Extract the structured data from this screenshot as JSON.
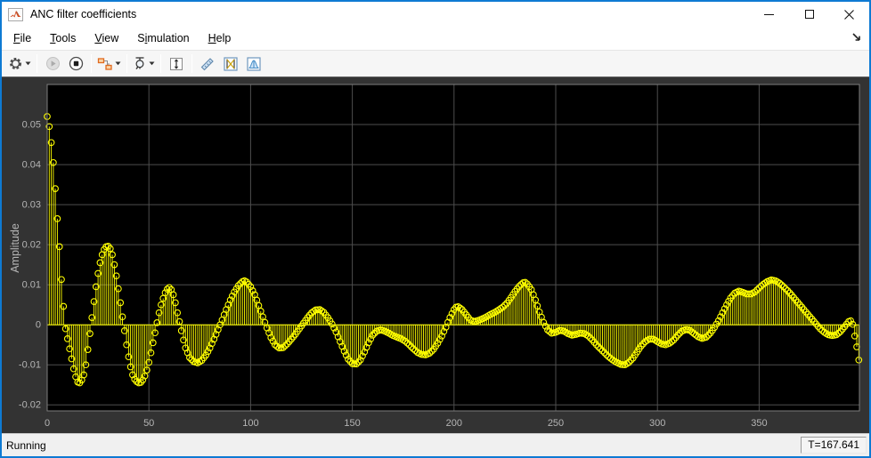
{
  "window": {
    "title": "ANC filter coefficients",
    "controls": {
      "minimize": "Minimize",
      "maximize": "Maximize",
      "close": "Close"
    }
  },
  "menu": {
    "items": [
      {
        "id": "file",
        "label": "File",
        "mnemonic": "F"
      },
      {
        "id": "tools",
        "label": "Tools",
        "mnemonic": "T"
      },
      {
        "id": "view",
        "label": "View",
        "mnemonic": "V"
      },
      {
        "id": "simulation",
        "label": "Simulation",
        "mnemonic": "i"
      },
      {
        "id": "help",
        "label": "Help",
        "mnemonic": "H"
      }
    ],
    "dock_icon": "dock-arrow-icon"
  },
  "toolbar": {
    "buttons": [
      {
        "id": "settings",
        "icon": "gear-icon",
        "dropdown": true,
        "enabled": true
      },
      {
        "sep": true
      },
      {
        "id": "run",
        "icon": "play-icon",
        "dropdown": false,
        "enabled": false
      },
      {
        "id": "stop",
        "icon": "stop-icon",
        "dropdown": false,
        "enabled": true
      },
      {
        "sep": true
      },
      {
        "id": "highlight-simulink-block",
        "icon": "simulink-blocks-icon",
        "dropdown": true,
        "enabled": true
      },
      {
        "sep": true
      },
      {
        "id": "zoom-tools",
        "icon": "zoom-span-icon",
        "dropdown": true,
        "enabled": true
      },
      {
        "sep": true
      },
      {
        "id": "scale-axes-limits",
        "icon": "scale-axes-icon",
        "dropdown": false,
        "enabled": true
      },
      {
        "sep": true
      },
      {
        "id": "measurements-ruler",
        "icon": "ruler-icon",
        "dropdown": false,
        "enabled": true
      },
      {
        "id": "cursor-measurements",
        "icon": "cursor-measurements-icon",
        "dropdown": false,
        "enabled": true
      },
      {
        "id": "signal-statistics",
        "icon": "signal-statistics-icon",
        "dropdown": false,
        "enabled": true
      }
    ]
  },
  "status_bar": {
    "state": "Running",
    "time": "T=167.641"
  },
  "colors": {
    "window_border": "#0e7ad3",
    "figure_background": "#333333",
    "axes_background": "#000000",
    "grid": "#4e4e4e",
    "axes_box": "#7d7d7d",
    "tick_label": "#b5b5b5",
    "stem": "#ffff00"
  },
  "chart_data": {
    "type": "stem",
    "title": "",
    "xlabel": "",
    "ylabel": "Amplitude",
    "xlim": [
      0,
      399.3
    ],
    "ylim": [
      -0.0215,
      0.06
    ],
    "x_ticks": [
      0,
      50,
      100,
      150,
      200,
      250,
      300,
      350
    ],
    "y_ticks": [
      -0.02,
      -0.01,
      0,
      0.01,
      0.02,
      0.03,
      0.04,
      0.05
    ],
    "y_tick_labels": [
      "-0.02",
      "-0.01",
      "0",
      "0.01",
      "0.02",
      "0.03",
      "0.04",
      "0.05"
    ],
    "grid": true,
    "legend": null,
    "n_samples": 400,
    "sampling_note": "400 filter taps; stems at every integer sample, values linearly interpolated from control_points read off the plot",
    "control_points": [
      [
        0,
        0.052
      ],
      [
        1,
        0.0495
      ],
      [
        2,
        0.0455
      ],
      [
        3,
        0.0405
      ],
      [
        4,
        0.034
      ],
      [
        5,
        0.0265
      ],
      [
        6,
        0.0195
      ],
      [
        7,
        0.0113
      ],
      [
        8,
        0.0046
      ],
      [
        9,
        -0.001
      ],
      [
        10,
        -0.0035
      ],
      [
        11,
        -0.006
      ],
      [
        12,
        -0.0085
      ],
      [
        13,
        -0.011
      ],
      [
        14,
        -0.013
      ],
      [
        15,
        -0.0143
      ],
      [
        16,
        -0.0145
      ],
      [
        17,
        -0.0138
      ],
      [
        18,
        -0.0125
      ],
      [
        19,
        -0.01
      ],
      [
        20,
        -0.0062
      ],
      [
        21,
        -0.0022
      ],
      [
        22,
        0.0018
      ],
      [
        23,
        0.0058
      ],
      [
        24,
        0.0095
      ],
      [
        25,
        0.0128
      ],
      [
        26,
        0.0155
      ],
      [
        27,
        0.0175
      ],
      [
        28,
        0.0188
      ],
      [
        29,
        0.0195
      ],
      [
        30,
        0.0196
      ],
      [
        31,
        0.019
      ],
      [
        32,
        0.0175
      ],
      [
        33,
        0.015
      ],
      [
        34,
        0.0122
      ],
      [
        35,
        0.009
      ],
      [
        36,
        0.0055
      ],
      [
        37,
        0.002
      ],
      [
        38,
        -0.0015
      ],
      [
        39,
        -0.005
      ],
      [
        40,
        -0.008
      ],
      [
        41,
        -0.0105
      ],
      [
        42,
        -0.0125
      ],
      [
        43,
        -0.0136
      ],
      [
        44,
        -0.0142
      ],
      [
        45,
        -0.0145
      ],
      [
        46,
        -0.0144
      ],
      [
        47,
        -0.0138
      ],
      [
        48,
        -0.0128
      ],
      [
        49,
        -0.0113
      ],
      [
        50,
        -0.0094
      ],
      [
        51,
        -0.007
      ],
      [
        52,
        -0.0045
      ],
      [
        53,
        -0.002
      ],
      [
        54,
        0.0005
      ],
      [
        55,
        0.003
      ],
      [
        56,
        0.005
      ],
      [
        57,
        0.0066
      ],
      [
        58,
        0.008
      ],
      [
        59,
        0.0089
      ],
      [
        60,
        0.0093
      ],
      [
        61,
        0.0088
      ],
      [
        62,
        0.0075
      ],
      [
        63,
        0.0055
      ],
      [
        64,
        0.003
      ],
      [
        65,
        0.0008
      ],
      [
        66,
        -0.0015
      ],
      [
        67,
        -0.0038
      ],
      [
        68,
        -0.0058
      ],
      [
        70,
        -0.0082
      ],
      [
        72,
        -0.0092
      ],
      [
        74,
        -0.0095
      ],
      [
        76,
        -0.0089
      ],
      [
        78,
        -0.0076
      ],
      [
        80,
        -0.0058
      ],
      [
        82,
        -0.0036
      ],
      [
        84,
        -0.0012
      ],
      [
        86,
        0.0012
      ],
      [
        88,
        0.0038
      ],
      [
        90,
        0.0062
      ],
      [
        92,
        0.0082
      ],
      [
        94,
        0.0098
      ],
      [
        96,
        0.0108
      ],
      [
        97,
        0.011
      ],
      [
        98,
        0.0107
      ],
      [
        100,
        0.0095
      ],
      [
        102,
        0.0075
      ],
      [
        104,
        0.0048
      ],
      [
        106,
        0.002
      ],
      [
        108,
        -0.0008
      ],
      [
        110,
        -0.0032
      ],
      [
        112,
        -0.005
      ],
      [
        114,
        -0.0058
      ],
      [
        116,
        -0.0057
      ],
      [
        118,
        -0.0048
      ],
      [
        120,
        -0.0036
      ],
      [
        122,
        -0.0024
      ],
      [
        124,
        -0.001
      ],
      [
        126,
        0.0004
      ],
      [
        128,
        0.0018
      ],
      [
        130,
        0.003
      ],
      [
        132,
        0.0037
      ],
      [
        134,
        0.0038
      ],
      [
        136,
        0.0031
      ],
      [
        138,
        0.0018
      ],
      [
        140,
        0.0002
      ],
      [
        142,
        -0.0018
      ],
      [
        144,
        -0.0042
      ],
      [
        146,
        -0.0066
      ],
      [
        148,
        -0.0086
      ],
      [
        150,
        -0.0097
      ],
      [
        152,
        -0.0098
      ],
      [
        154,
        -0.0088
      ],
      [
        156,
        -0.0068
      ],
      [
        158,
        -0.0045
      ],
      [
        160,
        -0.0026
      ],
      [
        162,
        -0.0016
      ],
      [
        164,
        -0.0013
      ],
      [
        166,
        -0.0016
      ],
      [
        168,
        -0.0021
      ],
      [
        170,
        -0.0027
      ],
      [
        172,
        -0.0031
      ],
      [
        174,
        -0.0035
      ],
      [
        176,
        -0.0041
      ],
      [
        178,
        -0.005
      ],
      [
        180,
        -0.006
      ],
      [
        182,
        -0.0069
      ],
      [
        184,
        -0.0074
      ],
      [
        186,
        -0.0075
      ],
      [
        188,
        -0.0071
      ],
      [
        190,
        -0.0061
      ],
      [
        192,
        -0.0046
      ],
      [
        194,
        -0.0028
      ],
      [
        196,
        -0.0006
      ],
      [
        198,
        0.0018
      ],
      [
        200,
        0.0038
      ],
      [
        201,
        0.0044
      ],
      [
        202,
        0.0045
      ],
      [
        204,
        0.0038
      ],
      [
        206,
        0.0025
      ],
      [
        208,
        0.0012
      ],
      [
        210,
        0.0008
      ],
      [
        212,
        0.0011
      ],
      [
        214,
        0.0015
      ],
      [
        216,
        0.002
      ],
      [
        218,
        0.0026
      ],
      [
        220,
        0.0031
      ],
      [
        222,
        0.0037
      ],
      [
        224,
        0.0044
      ],
      [
        226,
        0.0054
      ],
      [
        228,
        0.0068
      ],
      [
        230,
        0.0083
      ],
      [
        232,
        0.0096
      ],
      [
        234,
        0.0105
      ],
      [
        235,
        0.0106
      ],
      [
        236,
        0.0102
      ],
      [
        238,
        0.0088
      ],
      [
        240,
        0.0062
      ],
      [
        242,
        0.0032
      ],
      [
        244,
        0.0006
      ],
      [
        246,
        -0.0013
      ],
      [
        248,
        -0.0021
      ],
      [
        250,
        -0.0019
      ],
      [
        252,
        -0.0014
      ],
      [
        254,
        -0.0016
      ],
      [
        256,
        -0.0022
      ],
      [
        258,
        -0.0026
      ],
      [
        260,
        -0.0024
      ],
      [
        262,
        -0.0021
      ],
      [
        264,
        -0.0022
      ],
      [
        266,
        -0.0028
      ],
      [
        268,
        -0.0038
      ],
      [
        270,
        -0.005
      ],
      [
        272,
        -0.006
      ],
      [
        274,
        -0.007
      ],
      [
        276,
        -0.008
      ],
      [
        278,
        -0.0088
      ],
      [
        280,
        -0.0094
      ],
      [
        282,
        -0.0099
      ],
      [
        284,
        -0.01
      ],
      [
        286,
        -0.0094
      ],
      [
        288,
        -0.0083
      ],
      [
        290,
        -0.0068
      ],
      [
        292,
        -0.0053
      ],
      [
        294,
        -0.0042
      ],
      [
        296,
        -0.0036
      ],
      [
        298,
        -0.0036
      ],
      [
        300,
        -0.0042
      ],
      [
        302,
        -0.0048
      ],
      [
        304,
        -0.005
      ],
      [
        306,
        -0.0046
      ],
      [
        308,
        -0.0038
      ],
      [
        310,
        -0.0026
      ],
      [
        312,
        -0.0016
      ],
      [
        314,
        -0.0012
      ],
      [
        316,
        -0.0014
      ],
      [
        318,
        -0.0022
      ],
      [
        320,
        -0.003
      ],
      [
        322,
        -0.0034
      ],
      [
        324,
        -0.0031
      ],
      [
        326,
        -0.0021
      ],
      [
        328,
        -0.0007
      ],
      [
        330,
        0.001
      ],
      [
        332,
        0.003
      ],
      [
        334,
        0.005
      ],
      [
        336,
        0.0067
      ],
      [
        338,
        0.0079
      ],
      [
        340,
        0.0084
      ],
      [
        342,
        0.0081
      ],
      [
        344,
        0.0077
      ],
      [
        346,
        0.0077
      ],
      [
        348,
        0.0082
      ],
      [
        350,
        0.0092
      ],
      [
        352,
        0.0101
      ],
      [
        354,
        0.0108
      ],
      [
        356,
        0.0112
      ],
      [
        358,
        0.011
      ],
      [
        360,
        0.0104
      ],
      [
        362,
        0.0095
      ],
      [
        364,
        0.0085
      ],
      [
        366,
        0.0074
      ],
      [
        368,
        0.0062
      ],
      [
        370,
        0.005
      ],
      [
        372,
        0.0038
      ],
      [
        374,
        0.0026
      ],
      [
        376,
        0.0014
      ],
      [
        378,
        0.0002
      ],
      [
        380,
        -0.001
      ],
      [
        382,
        -0.0019
      ],
      [
        384,
        -0.0025
      ],
      [
        386,
        -0.0027
      ],
      [
        388,
        -0.0025
      ],
      [
        390,
        -0.0017
      ],
      [
        392,
        -0.0005
      ],
      [
        394,
        0.0008
      ],
      [
        395,
        0.001
      ],
      [
        396,
        0.0001
      ],
      [
        397,
        -0.0028
      ],
      [
        398,
        -0.0055
      ],
      [
        399,
        -0.0088
      ]
    ]
  }
}
